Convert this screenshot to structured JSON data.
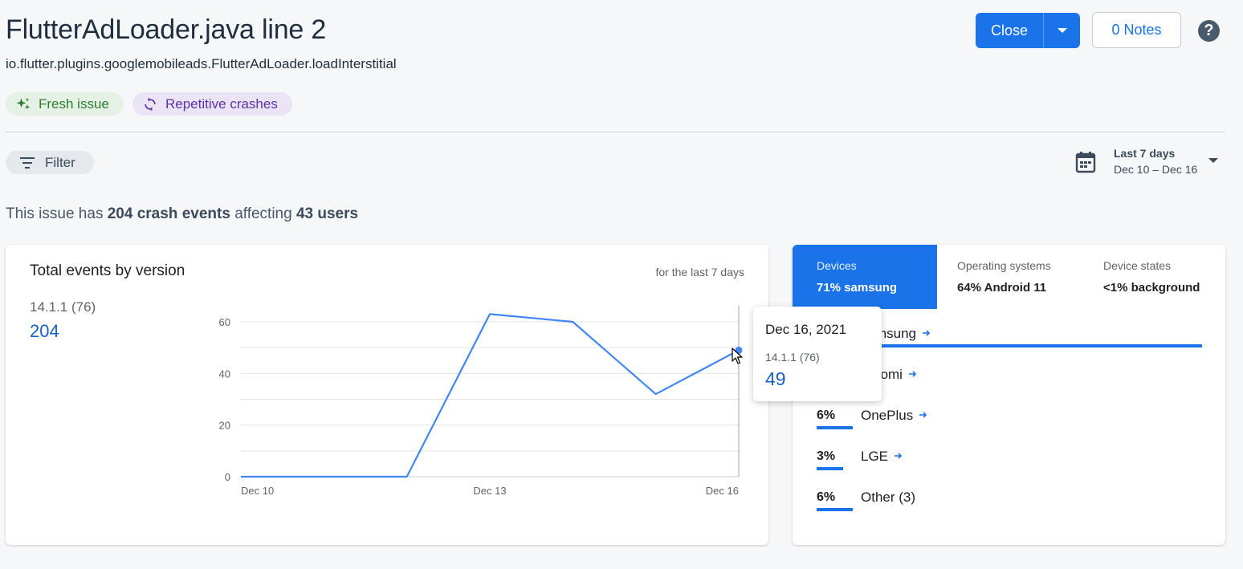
{
  "header": {
    "title": "FlutterAdLoader.java line 2",
    "subtitle": "io.flutter.plugins.googlemobileads.FlutterAdLoader.loadInterstitial",
    "chips": [
      {
        "label": "Fresh issue",
        "icon": "sparkle-icon"
      },
      {
        "label": "Repetitive crashes",
        "icon": "repeat-icon"
      }
    ],
    "close_label": "Close",
    "notes_label": "0 Notes",
    "help_label": "?"
  },
  "toolbar": {
    "filter_label": "Filter",
    "date_title": "Last 7 days",
    "date_range": "Dec 10 – Dec 16"
  },
  "summary": {
    "prefix": "This issue has",
    "events": "204 crash events",
    "middle": "affecting",
    "users": "43 users"
  },
  "events_card": {
    "title": "Total events by version",
    "period": "for the last 7 days",
    "legend_name": "14.1.1 (76)",
    "legend_total": "204"
  },
  "tooltip": {
    "date": "Dec 16, 2021",
    "version": "14.1.1 (76)",
    "value": "49"
  },
  "chart_data": {
    "type": "line",
    "x": [
      "Dec 10",
      "Dec 11",
      "Dec 12",
      "Dec 13",
      "Dec 14",
      "Dec 15",
      "Dec 16"
    ],
    "x_tick_labels": [
      "Dec 10",
      "Dec 13",
      "Dec 16"
    ],
    "series": [
      {
        "name": "14.1.1 (76)",
        "values": [
          0,
          0,
          0,
          63,
          60,
          32,
          49
        ],
        "color": "#4285f4"
      }
    ],
    "ylim": [
      0,
      60
    ],
    "y_ticks": [
      0,
      20,
      40,
      60
    ],
    "grid": true,
    "title": "Total events by version"
  },
  "distribution": {
    "tabs": [
      {
        "label": "Devices",
        "value": "71% samsung",
        "active": true
      },
      {
        "label": "Operating systems",
        "value": "64% Android 11",
        "active": false
      },
      {
        "label": "Device states",
        "value": "<1% background",
        "active": false
      }
    ],
    "rows": [
      {
        "pct": "71%",
        "name": "samsung",
        "bar_fraction": 0.71,
        "has_link": true
      },
      {
        "pct": "",
        "name": "Xiaomi",
        "bar_fraction": 0.14,
        "has_link": true
      },
      {
        "pct": "6%",
        "name": "OnePlus",
        "bar_fraction": 0.06,
        "has_link": true
      },
      {
        "pct": "3%",
        "name": "LGE",
        "bar_fraction": 0.03,
        "has_link": true
      },
      {
        "pct": "6%",
        "name": "Other (3)",
        "bar_fraction": 0.06,
        "has_link": false
      }
    ]
  },
  "colors": {
    "accent": "#1a73e8",
    "series": "#4285f4",
    "fresh_chip_bg": "#e5f1e4",
    "repetitive_chip_bg": "#ebe3f6"
  }
}
